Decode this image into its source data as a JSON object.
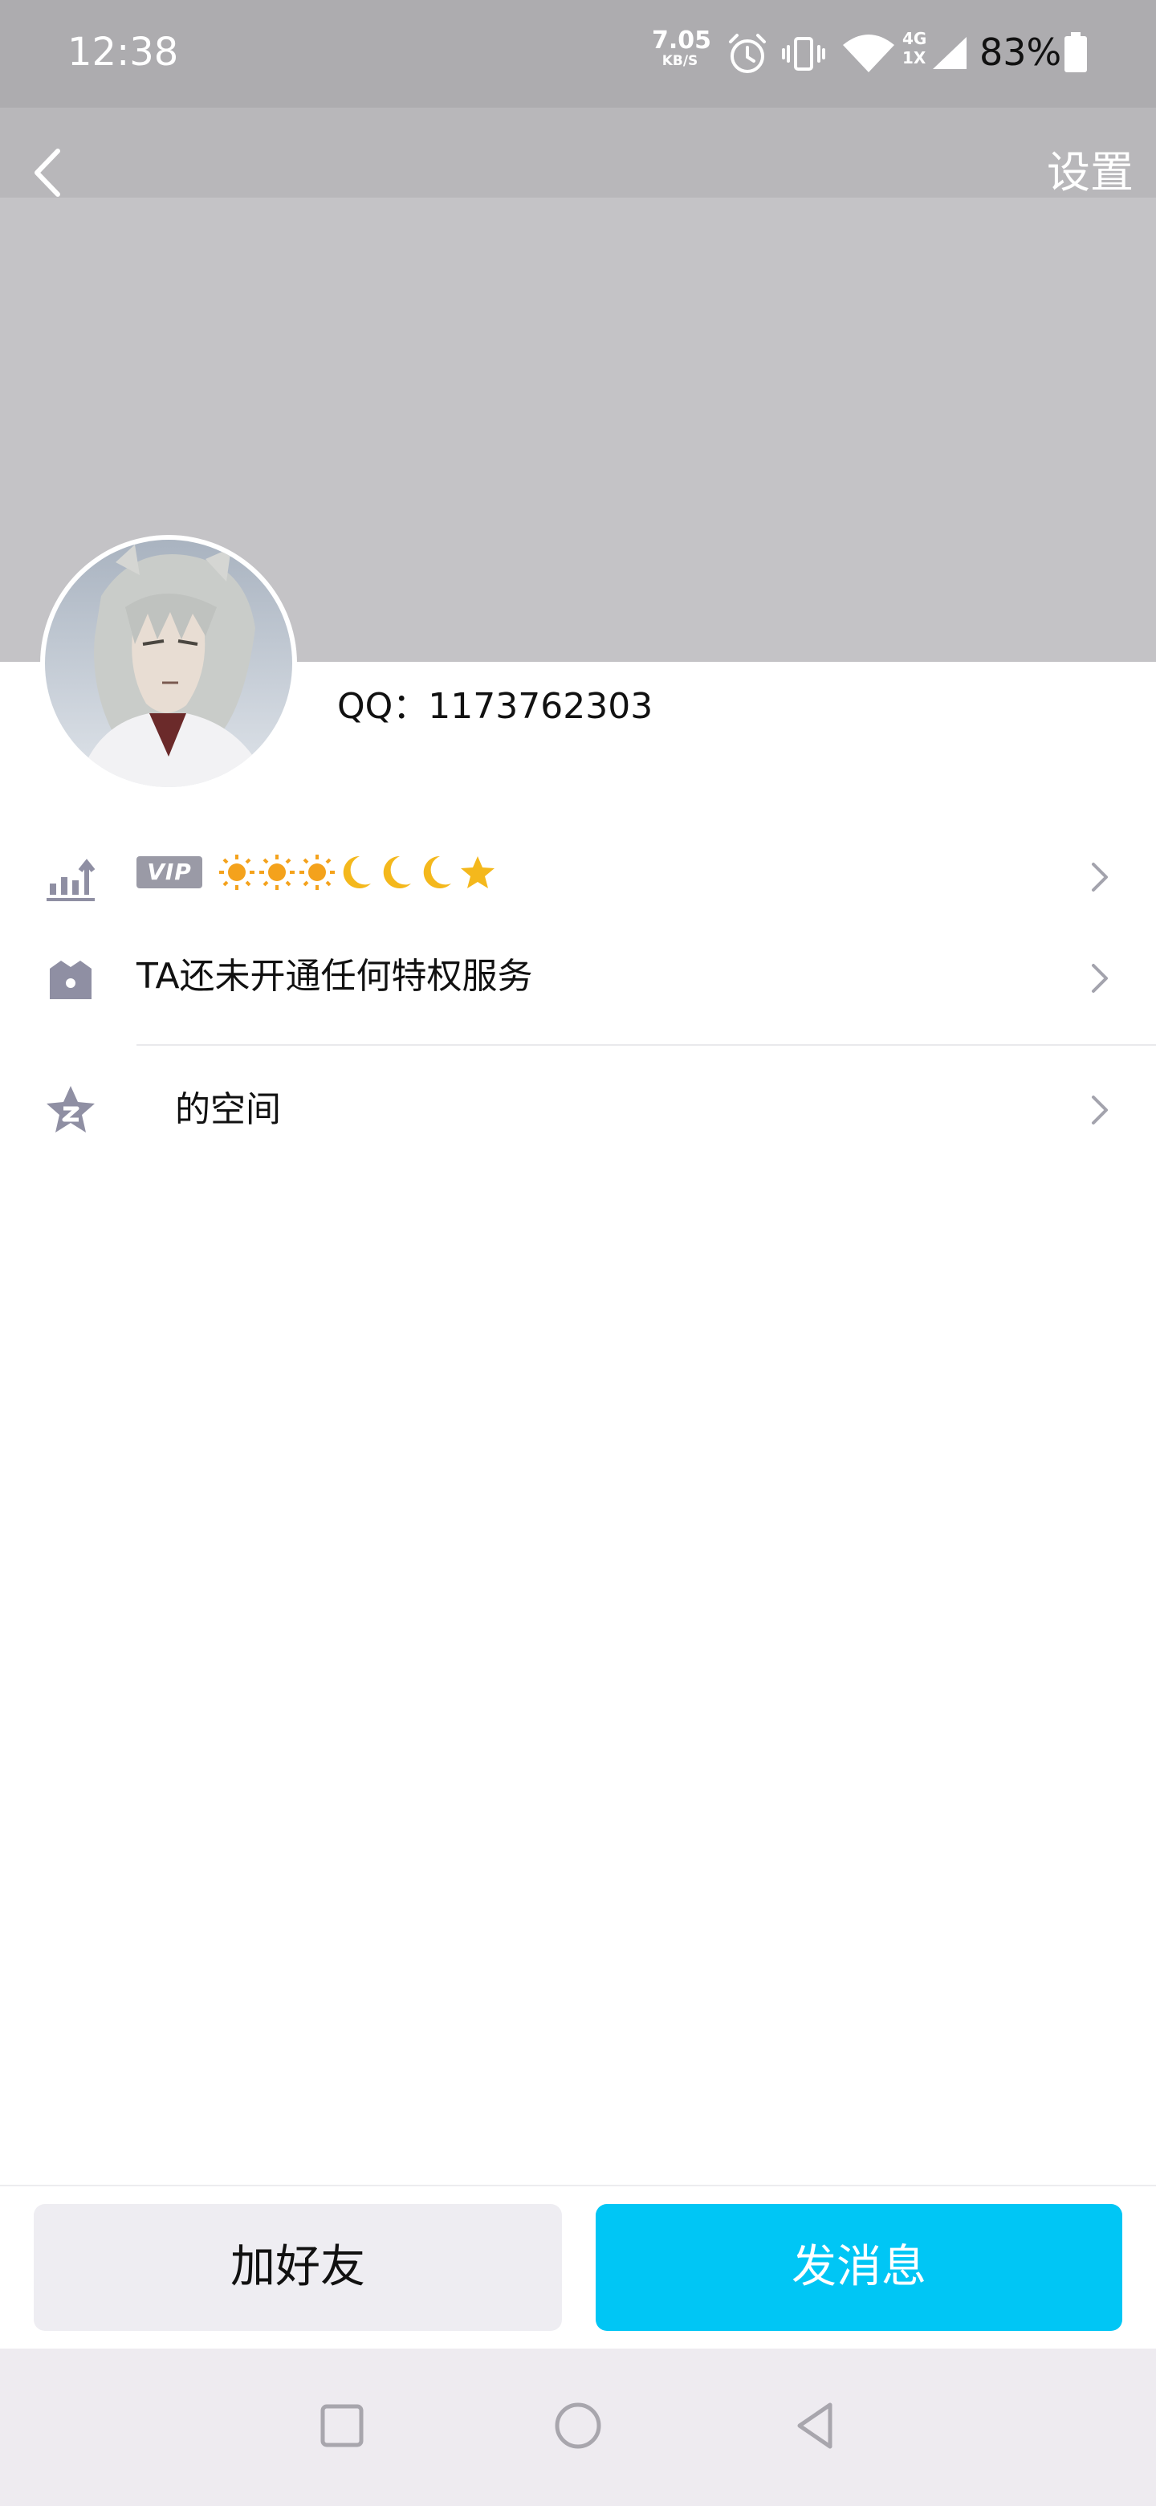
{
  "status_bar": {
    "time": "12:38",
    "net_speed": "7.05",
    "net_unit": "KB/S",
    "net_type_top": "4G",
    "net_type_bottom": "1X",
    "battery": "83%"
  },
  "header": {
    "back_icon": "chevron-left-icon",
    "settings_label": "设置"
  },
  "profile": {
    "qq_label": "QQ：1173762303"
  },
  "rows": {
    "vip": {
      "badge": "VIP",
      "level_icons": [
        "sun",
        "sun",
        "sun",
        "moon",
        "moon",
        "moon",
        "star"
      ]
    },
    "privilege": {
      "label": "TA还未开通任何特权服务"
    },
    "space": {
      "label": "的空间"
    }
  },
  "actions": {
    "add_friend": "加好友",
    "send_message": "发消息"
  },
  "colors": {
    "accent": "#00c6f5",
    "cover": "#c4c3c6",
    "icon_gray": "#8f8fa3"
  }
}
